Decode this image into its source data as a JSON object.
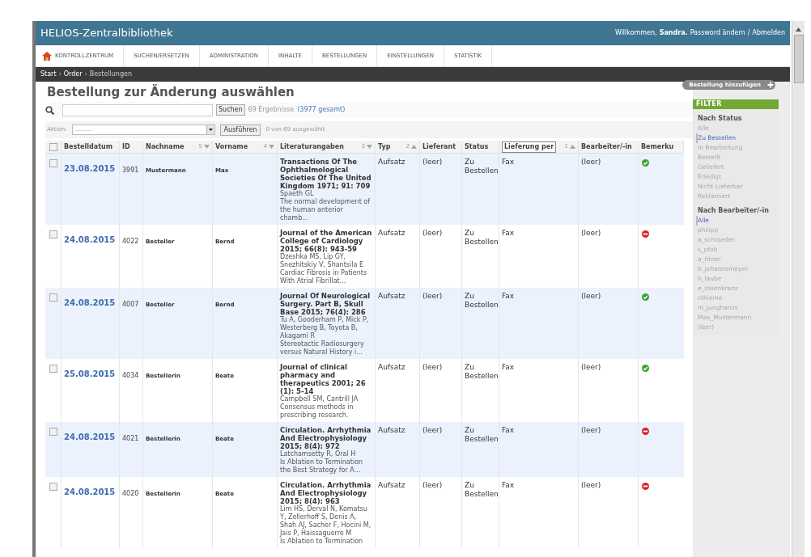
{
  "header": {
    "title": "HELIOS-Zentralbibliothek",
    "welcome": "Willkommen,",
    "user": "Sandra.",
    "links": [
      "Password ändern",
      "Abmelden"
    ],
    "separator": "/"
  },
  "nav": [
    {
      "label": "KONTROLLZENTRUM"
    },
    {
      "label": "SUCHEN/ERSETZEN"
    },
    {
      "label": "ADMINISTRATION"
    },
    {
      "label": "INHALTE"
    },
    {
      "label": "BESTELLUNGEN"
    },
    {
      "label": "EINSTELLUNGEN"
    },
    {
      "label": "STATISTIK"
    }
  ],
  "breadcrumb": [
    "Start",
    "Order",
    "Bestellungen"
  ],
  "breadcrumb_separator": "›",
  "select_all_checked": false,
  "page_title": "Bestellung zur Änderung auswählen",
  "add_button": "Bestellung hinzufügen",
  "search": {
    "button": "Suchen",
    "results": "69 Ergebnisse",
    "total": "(3977 gesamt)"
  },
  "action": {
    "label": "Aktion:",
    "value": "---------",
    "button": "Ausführen",
    "selection": "0 von 69 ausgewählt"
  },
  "columns": [
    {
      "label": "Bestelldatum"
    },
    {
      "label": "ID"
    },
    {
      "label": "Nachname",
      "sort": "5",
      "ascending": false
    },
    {
      "label": "Vorname",
      "sort": "4",
      "ascending": false
    },
    {
      "label": "Literaturangaben",
      "sort": "3",
      "ascending": false
    },
    {
      "label": "Typ",
      "sort": "2",
      "ascending": true
    },
    {
      "label": "Lieferant"
    },
    {
      "label": "Status"
    },
    {
      "label": "Lieferung per",
      "sort": "1",
      "ascending": true,
      "focused": true
    },
    {
      "label": "Bearbeiter/-in"
    },
    {
      "label": "Bemerku"
    }
  ],
  "rows": [
    {
      "checked": false,
      "date": "23.08.2015",
      "id": "3991",
      "lastname": "Mustermann",
      "firstname": "Max",
      "lit_title": "Transactions Of The Ophthalmological Societies Of The United Kingdom 1971; 91: 709",
      "lit_authors": "Spaeth GL",
      "lit_subject": "The normal development of the human anterior chamb...",
      "type": "Aufsatz",
      "supplier": "(leer)",
      "status": "Zu Bestellen",
      "delivery": "Fax",
      "editor": "(leer)",
      "remark_ok": true
    },
    {
      "checked": false,
      "date": "24.08.2015",
      "id": "4022",
      "lastname": "Besteller",
      "firstname": "Bernd",
      "lit_title": "Journal of the American College of Cardiology 2015; 66(8): 943-59",
      "lit_authors": "Dzeshka MS, Lip GY, Snezhitskiy V, Shantsila E",
      "lit_subject": "Cardiac Fibrosis in Patients With Atrial Fibrillat...",
      "type": "Aufsatz",
      "supplier": "(leer)",
      "status": "Zu Bestellen",
      "delivery": "Fax",
      "editor": "(leer)",
      "remark_ok": false
    },
    {
      "checked": false,
      "date": "24.08.2015",
      "id": "4007",
      "lastname": "Besteller",
      "firstname": "Bernd",
      "lit_title": "Journal Of Neurological Surgery. Part B, Skull Base 2015; 76(4): 286",
      "lit_authors": "Tu A, Gooderham P, Mick P, Westerberg B, Toyota B, Akagami R",
      "lit_subject": "Stereotactic Radiosurgery versus Natural History i...",
      "type": "Aufsatz",
      "supplier": "(leer)",
      "status": "Zu Bestellen",
      "delivery": "Fax",
      "editor": "(leer)",
      "remark_ok": true
    },
    {
      "checked": false,
      "date": "25.08.2015",
      "id": "4034",
      "lastname": "Bestellerin",
      "firstname": "Beate",
      "lit_title": "Journal of clinical pharmacy and therapeutics 2001; 26 (1): 5-14",
      "lit_authors": "Campbell SM, Cantrill JA",
      "lit_subject": "Consensus methods in prescribing research.",
      "type": "Aufsatz",
      "supplier": "(leer)",
      "status": "Zu Bestellen",
      "delivery": "Fax",
      "editor": "(leer)",
      "remark_ok": true
    },
    {
      "checked": false,
      "date": "24.08.2015",
      "id": "4021",
      "lastname": "Bestellerin",
      "firstname": "Beate",
      "lit_title": "Circulation. Arrhythmia And Electrophysiology 2015; 8(4): 972",
      "lit_authors": "Latchamsetty R, Oral H",
      "lit_subject": "Is Ablation to Termination the Best Strategy for A...",
      "type": "Aufsatz",
      "supplier": "(leer)",
      "status": "Zu Bestellen",
      "delivery": "Fax",
      "editor": "(leer)",
      "remark_ok": false
    },
    {
      "checked": false,
      "date": "24.08.2015",
      "id": "4020",
      "lastname": "Bestellerin",
      "firstname": "Beate",
      "lit_title": "Circulation. Arrhythmia And Electrophysiology 2015; 8(4): 963",
      "lit_authors": "Lim HS, Derval N, Komatsu Y, Zellerhoff S, Denis A, Shah AJ, Sacher F, Hocini M, Jais P, Haissaguerre M",
      "lit_subject": "Is Ablation to Termination",
      "type": "Aufsatz",
      "supplier": "(leer)",
      "status": "Zu Bestellen",
      "delivery": "Fax",
      "editor": "(leer)",
      "remark_ok": false
    }
  ],
  "filter": {
    "title": "FILTER",
    "sections": [
      {
        "heading": "Nach Status",
        "items": [
          {
            "label": "Alle",
            "selected": false
          },
          {
            "label": "Zu Bestellen",
            "selected": true
          },
          {
            "label": "In Bearbeitung",
            "selected": false
          },
          {
            "label": "Bestellt",
            "selected": false
          },
          {
            "label": "Geliefert",
            "selected": false
          },
          {
            "label": "Erledigt",
            "selected": false
          },
          {
            "label": "Nicht Lieferbar",
            "selected": false
          },
          {
            "label": "Reklamiert",
            "selected": false
          }
        ]
      },
      {
        "heading": "Nach Bearbeiter/-in",
        "items": [
          {
            "label": "Alle",
            "selected": true
          },
          {
            "label": "philipp",
            "selected": false
          },
          {
            "label": "a_schroeder",
            "selected": false
          },
          {
            "label": "s_pfob",
            "selected": false
          },
          {
            "label": "a_ittner",
            "selected": false
          },
          {
            "label": "b_johannsmeyer",
            "selected": false
          },
          {
            "label": "h_laube",
            "selected": false
          },
          {
            "label": "e_rosenkranz",
            "selected": false
          },
          {
            "label": "cthieme",
            "selected": false
          },
          {
            "label": "m_junghanss",
            "selected": false
          },
          {
            "label": "Max_Mustermann",
            "selected": false
          },
          {
            "label": "(leer)",
            "selected": false
          }
        ]
      }
    ]
  }
}
